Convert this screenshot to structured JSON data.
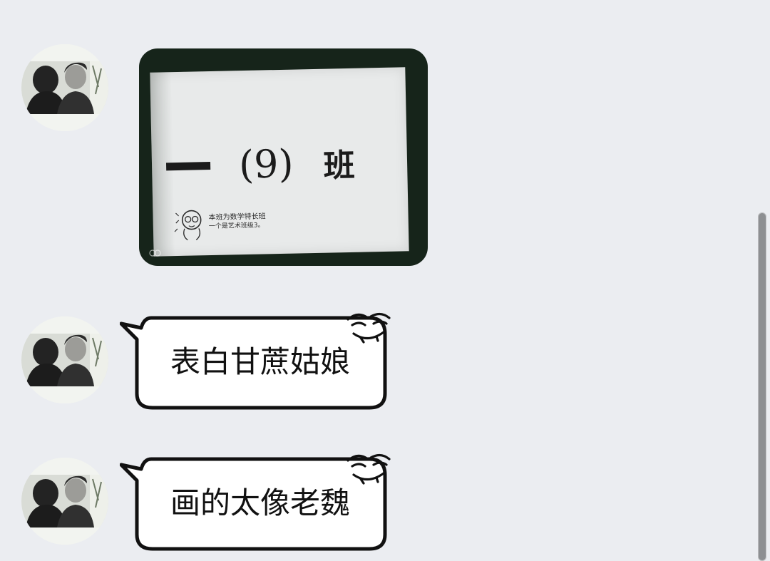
{
  "messages": [
    {
      "type": "image",
      "avatar": "avatar-photo-icon",
      "image": {
        "class_number": "(9)",
        "class_prefix": "一",
        "class_suffix": "班",
        "note_line_1": "本班为数学特长班",
        "note_line_2": "一个是艺术班级3。"
      }
    },
    {
      "type": "sticker-bubble",
      "avatar": "avatar-photo-icon",
      "text": "表白甘蔗姑娘"
    },
    {
      "type": "sticker-bubble",
      "avatar": "avatar-photo-icon",
      "text": "画的太像老魏"
    }
  ],
  "colors": {
    "background": "#ebedf1",
    "bubble_fill": "#ffffff",
    "bubble_outline": "#111111",
    "scrollbar": "#8d8f92"
  }
}
